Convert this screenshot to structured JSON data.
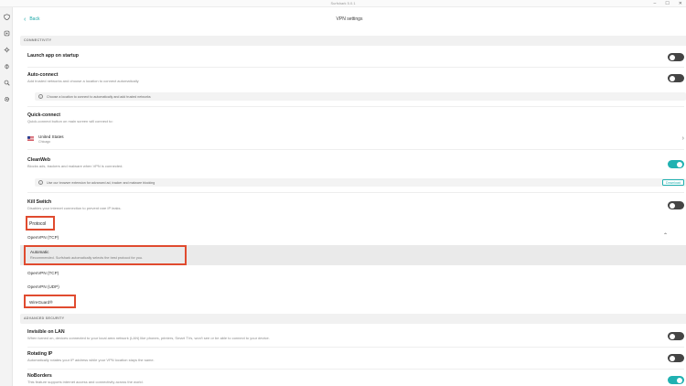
{
  "window": {
    "title": "Surfshark 5.0.1"
  },
  "iconbar": {
    "icons": [
      "shield-icon",
      "alert-icon",
      "settings-icon",
      "bug-icon",
      "search-icon",
      "gear-icon"
    ]
  },
  "header": {
    "back_label": "Back",
    "title": "VPN settings"
  },
  "sections": {
    "connectivity": "CONNECTIVITY",
    "advanced_security": "ADVANCED SECURITY"
  },
  "launch": {
    "title": "Launch app on startup",
    "enabled": false
  },
  "autoconnect": {
    "title": "Auto-connect",
    "desc": "Add trusted networks and choose a location to connect automatically",
    "info": "Choose a location to connect to automatically and add trusted networks",
    "enabled": false
  },
  "quickconnect": {
    "title": "Quick-connect",
    "desc": "Quick-connect button on main screen will connect to:",
    "location": {
      "name": "United States",
      "city": "Chicago"
    }
  },
  "cleanweb": {
    "title": "CleanWeb",
    "desc": "Blocks ads, trackers and malware when VPN is connected.",
    "info": "Use our browser extension for advanced ad, tracker and malware blocking",
    "download_label": "Download",
    "enabled": true
  },
  "killswitch": {
    "title": "Kill Switch",
    "desc": "Disables your internet connection to prevent rare IP leaks.",
    "enabled": false
  },
  "protocol": {
    "label": "Protocol",
    "current": "OpenVPN (TCP)",
    "options": [
      {
        "name": "Automatic",
        "desc": "Recommended. Surfshark automatically selects the best protocol for you."
      },
      {
        "name": "OpenVPN (TCP)"
      },
      {
        "name": "OpenVPN (UDP)"
      },
      {
        "name": "WireGuard®"
      }
    ]
  },
  "invisible": {
    "title": "Invisible on LAN",
    "desc": "When turned on, devices connected to your local area network (LAN) like phones, printers, Smart TVs, won't see or be able to connect to your device.",
    "enabled": false
  },
  "rotating": {
    "title": "Rotating IP",
    "desc": "Automatically rotates your IP address while your VPN location stays the same.",
    "enabled": false
  },
  "noborders": {
    "title": "NoBorders",
    "desc": "This feature supports internet access and connectivity across the world.",
    "enabled": true
  },
  "colors": {
    "accent": "#20b1b1",
    "highlight_box": "#e04b2f"
  }
}
